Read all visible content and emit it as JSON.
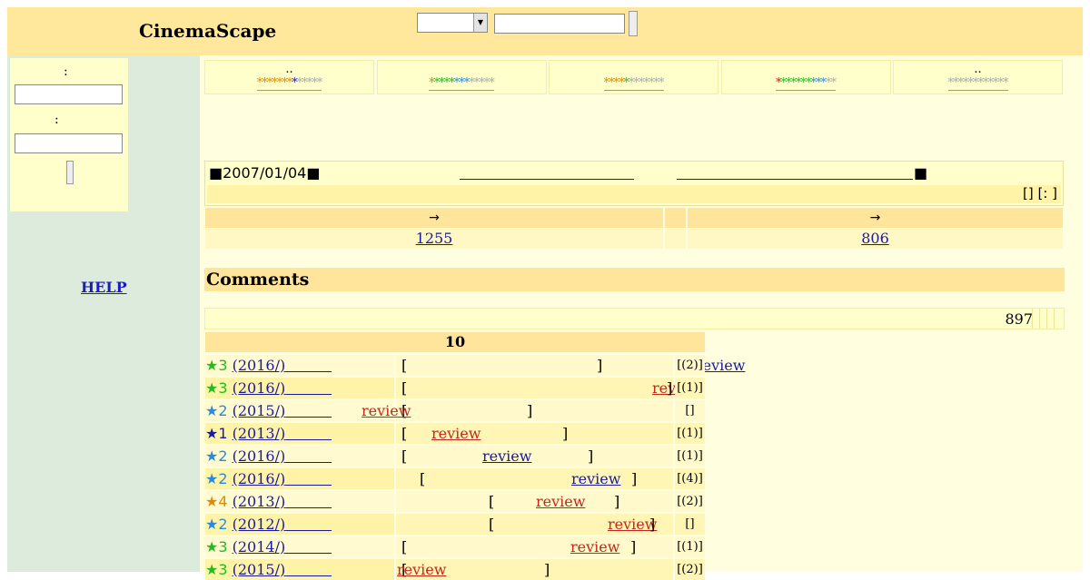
{
  "header": {
    "logo": "CinemaScape"
  },
  "sidebar": {
    "login": {
      "label1": ":",
      "label2": ":"
    },
    "help": "HELP"
  },
  "stars": [
    {
      "dots": "..",
      "segments": [
        {
          "t": "*******",
          "c": "s-or"
        },
        {
          "t": "*",
          "c": "s-db"
        },
        {
          "t": "*****",
          "c": "s-gy"
        }
      ]
    },
    {
      "dots": "",
      "segments": [
        {
          "t": "*",
          "c": "s-or"
        },
        {
          "t": "****",
          "c": "s-gr"
        },
        {
          "t": "***",
          "c": "s-lb"
        },
        {
          "t": "*****",
          "c": "s-gy"
        }
      ]
    },
    {
      "dots": "",
      "segments": [
        {
          "t": "****",
          "c": "s-or"
        },
        {
          "t": "*",
          "c": "s-gr"
        },
        {
          "t": "*******",
          "c": "s-gy"
        }
      ]
    },
    {
      "dots": "",
      "segments": [
        {
          "t": "*",
          "c": "s-rd"
        },
        {
          "t": "******",
          "c": "s-gr"
        },
        {
          "t": "***",
          "c": "s-lb"
        },
        {
          "t": "**",
          "c": "s-gy"
        }
      ]
    },
    {
      "dots": "..",
      "segments": [
        {
          "t": "************",
          "c": "s-gy"
        }
      ]
    }
  ],
  "info": {
    "date": "■2007/01/04■",
    "marker": "■",
    "tail": "[] [:     ]"
  },
  "counts": {
    "arrow1": "→",
    "arrow2": "→",
    "value1": "1255",
    "value2": "806"
  },
  "comments": {
    "title": "Comments",
    "total": "897",
    "table_header": "10",
    "rows": [
      {
        "star": "★3",
        "color": "c-gr",
        "year": "(2016/)",
        "review": "review",
        "rev_color": "",
        "cnt": "[(2)]",
        "pre": "["
      },
      {
        "star": "★3",
        "color": "c-gr",
        "year": "(2016/)",
        "review": "review",
        "rev_color": "red",
        "cnt": "[(1)]",
        "pre": "["
      },
      {
        "star": "★2",
        "color": "c-lb",
        "year": "(2015/)",
        "review": "review",
        "rev_color": "red",
        "cnt": "[]",
        "pre": "["
      },
      {
        "star": "★1",
        "color": "c-db",
        "year": "(2013/)",
        "review": "review",
        "rev_color": "red",
        "cnt": "[(1)]",
        "pre": "["
      },
      {
        "star": "★2",
        "color": "c-lb",
        "year": "(2016/)",
        "review": "review",
        "rev_color": "",
        "cnt": "[(1)]",
        "pre": "["
      },
      {
        "star": "★2",
        "color": "c-lb",
        "year": "(2016/)",
        "review": "review",
        "rev_color": "",
        "cnt": "[(4)]",
        "pre": "["
      },
      {
        "star": "★4",
        "color": "c-or",
        "year": "(2013/)",
        "review": "review",
        "rev_color": "red",
        "cnt": "[(2)]",
        "pre": "["
      },
      {
        "star": "★2",
        "color": "c-lb",
        "year": "(2012/)",
        "review": "review",
        "rev_color": "red",
        "cnt": "[]",
        "pre": "["
      },
      {
        "star": "★3",
        "color": "c-gr",
        "year": "(2014/)",
        "review": "review",
        "rev_color": "red",
        "cnt": "[(1)]",
        "pre": "["
      },
      {
        "star": "★3",
        "color": "c-gr",
        "year": "(2015/)",
        "review": "review",
        "rev_color": "red",
        "cnt": "[(2)]",
        "pre": "["
      }
    ]
  }
}
